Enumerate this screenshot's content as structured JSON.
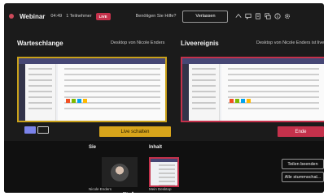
{
  "topbar": {
    "title": "Webinar",
    "time": "04:49",
    "participants": "1 Teilnehmer",
    "live_badge": "LIVE",
    "help": "Benötigen Sie Hilfe?",
    "leave_label": "Verlassen",
    "icons": [
      "reactions-icon",
      "chat-icon",
      "notes-icon",
      "qna-icon",
      "info-icon",
      "settings-icon"
    ]
  },
  "queue": {
    "title": "Warteschlange",
    "subtitle": "Desktop von Nicole Enders"
  },
  "live_event": {
    "title": "Liveereignis",
    "subtitle": "Desktop von Nicole Enders ist live"
  },
  "controls": {
    "go_live_label": "Live schalten",
    "end_label": "Ende"
  },
  "bottom": {
    "you_label": "Sie",
    "content_label": "Inhalt",
    "presenter_name": "Nicole Enders",
    "desktop_label": "Mein Desktop",
    "stop_sharing_label": "Teilen beenden",
    "mute_all_label": "Alle stummschal..."
  },
  "colors": {
    "accent_gold": "#d8a51b",
    "accent_red": "#c4314b",
    "teams_purple": "#464775"
  }
}
